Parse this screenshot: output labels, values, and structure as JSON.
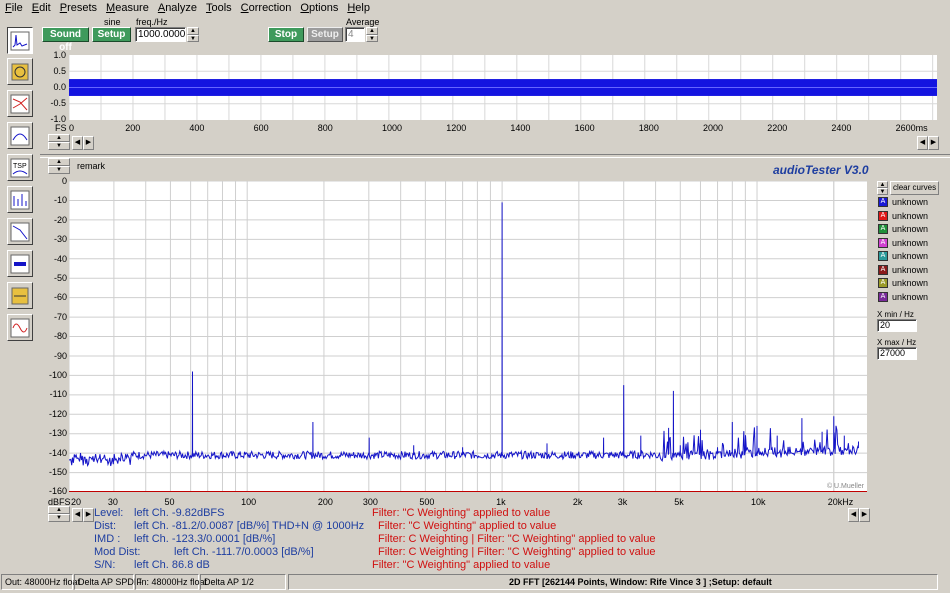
{
  "menu": [
    "File",
    "Edit",
    "Presets",
    "Measure",
    "Analyze",
    "Tools",
    "Correction",
    "Options",
    "Help"
  ],
  "menu_underline": [
    "F",
    "E",
    "P",
    "M",
    "A",
    "T",
    "C",
    "O",
    "H"
  ],
  "generator": {
    "sound_label": "Sound off",
    "setup_label": "Setup",
    "wave_label": "sine",
    "freq_label": "freq./Hz",
    "freq_value": "1000.0000"
  },
  "analyzer": {
    "stop_label": "Stop",
    "setup_label": "Setup",
    "average_label": "Average",
    "average_value": "4"
  },
  "top_plot": {
    "yticks": [
      "1.0",
      "0.5",
      "0.0",
      "-0.5",
      "-1.0"
    ],
    "xticks": [
      "FS 0",
      "200",
      "400",
      "600",
      "800",
      "1000",
      "1200",
      "1400",
      "1600",
      "1800",
      "2000",
      "2200",
      "2400",
      "2600ms"
    ]
  },
  "remark_label": "remark",
  "app_title": "audioTester  V3.0",
  "copyright": "© U.Mueller",
  "main_plot": {
    "yticks": [
      "0",
      "-10",
      "-20",
      "-30",
      "-40",
      "-50",
      "-60",
      "-70",
      "-80",
      "-90",
      "-100",
      "-110",
      "-120",
      "-130",
      "-140",
      "-150",
      "-160"
    ],
    "y_unit": "dBFS",
    "xticks": [
      "20",
      "30",
      "50",
      "100",
      "200",
      "300",
      "500",
      "1k",
      "2k",
      "3k",
      "5k",
      "10k",
      "20kHz"
    ]
  },
  "legend": {
    "clear_label": "clear curves",
    "entries": [
      {
        "letter": "A",
        "name": "unknown",
        "color": "#1a1ad6"
      },
      {
        "letter": "A",
        "name": "unknown",
        "color": "#e01818"
      },
      {
        "letter": "A",
        "name": "unknown",
        "color": "#1f8f3a"
      },
      {
        "letter": "A",
        "name": "unknown",
        "color": "#d040d0"
      },
      {
        "letter": "A",
        "name": "unknown",
        "color": "#2a9a9a"
      },
      {
        "letter": "A",
        "name": "unknown",
        "color": "#8a1a1a"
      },
      {
        "letter": "A",
        "name": "unknown",
        "color": "#9a9a2a"
      },
      {
        "letter": "A",
        "name": "unknown",
        "color": "#7a2a9a"
      }
    ],
    "xmin_label": "X min / Hz",
    "xmin_value": "20",
    "xmax_label": "X max / Hz",
    "xmax_value": "27000"
  },
  "readout": {
    "level_label": "Level:",
    "level_value": "left Ch. -9.82dBFS",
    "dist_label": "Dist:",
    "dist_value": "left Ch. -81.2/0.0087 [dB/%] THD+N  @ 1000Hz",
    "imd_label": "IMD  :",
    "imd_value": "left Ch. -123.3/0.0001 [dB/%]",
    "moddist_label": "Mod Dist:",
    "moddist_value": "left Ch. -111.7/0.0003 [dB/%]",
    "sn_label": "S/N:",
    "sn_value": "left Ch. 86.8 dB",
    "filter1": "Filter: \"C Weighting\" applied to value",
    "filter2": "Filter: \"C Weighting\" applied to value",
    "filter3": "Filter: C Weighting | Filter: \"C Weighting\" applied to value",
    "filter4": "Filter: C Weighting | Filter: \"C Weighting\" applied to value",
    "filter5": "Filter: \"C Weighting\" applied to value"
  },
  "status": {
    "out": "Out: 48000Hz float",
    "out_dev": "Delta AP SPDIF",
    "in": "In: 48000Hz float",
    "in_dev": "Delta AP 1/2",
    "fft": "2D FFT [262144 Points, Window: Rife Vince 3 ] ;Setup:  default"
  },
  "colors": {
    "trace": "#1414c8",
    "grid": "#c8c8c8",
    "accent_green": "#3f9a5c",
    "title_blue": "#1e3ea0",
    "filter_red": "#d01010"
  },
  "chart_data": {
    "type": "line",
    "x_scale": "log",
    "xlim": [
      20,
      27000
    ],
    "ylim": [
      -160,
      0
    ],
    "ylabel": "dBFS",
    "series": [
      {
        "x": [
          20,
          25,
          30,
          40,
          50,
          60,
          61,
          62,
          70,
          80,
          100,
          150,
          180,
          181,
          200,
          250,
          300,
          301,
          350,
          400,
          450,
          500,
          600,
          700,
          800,
          900,
          999,
          1000,
          1001,
          1100,
          1200,
          1500,
          1800,
          2000,
          2500,
          2900,
          3000,
          3100,
          3500,
          4000,
          4500,
          4700,
          5000,
          6000,
          7000,
          8000,
          9000,
          10000,
          12000,
          15000,
          18000,
          20000,
          22000,
          25000
        ],
        "y": [
          -143,
          -145,
          -141,
          -140,
          -141,
          -140,
          -98,
          -140,
          -141,
          -142,
          -141,
          -141,
          -140,
          -124,
          -141,
          -140,
          -141,
          -132,
          -141,
          -140,
          -136,
          -141,
          -140,
          -137,
          -141,
          -140,
          -141,
          -11,
          -141,
          -138,
          -140,
          -135,
          -139,
          -140,
          -132,
          -139,
          -105,
          -138,
          -131,
          -138,
          -127,
          -108,
          -136,
          -128,
          -137,
          -124,
          -133,
          -126,
          -131,
          -122,
          -129,
          -121,
          -131,
          -134
        ]
      }
    ]
  }
}
